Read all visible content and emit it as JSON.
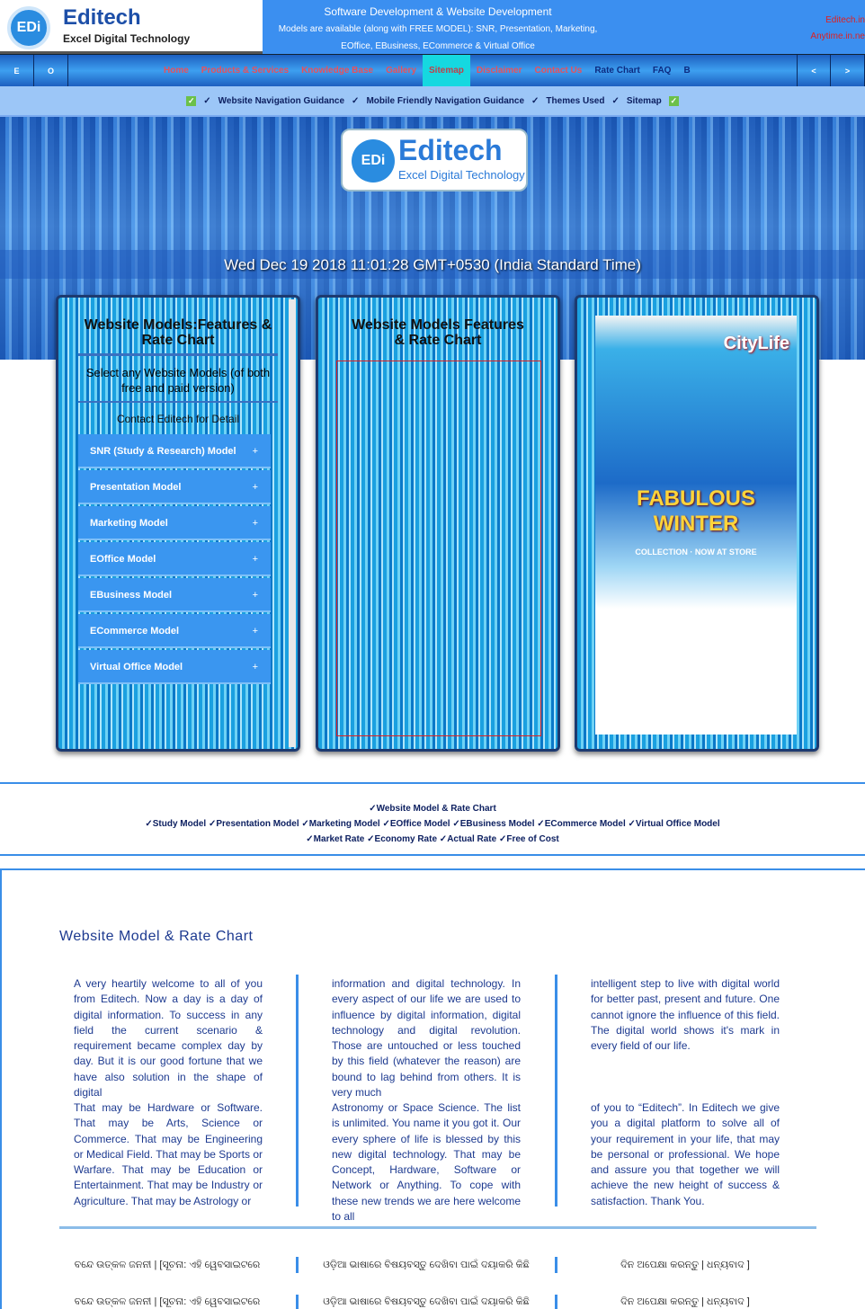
{
  "header": {
    "brand": "Editech",
    "tagline": "Excel Digital Technology",
    "logo_mark": "EDi",
    "promo": [
      "Software Development & Website Development",
      "Models are available (along with FREE MODEL): SNR, Presentation, Marketing,",
      "EOffice, EBusiness, ECommerce & Virtual Office"
    ],
    "side_links": [
      "Editech.in",
      "Anytime.in.ne"
    ]
  },
  "nav": {
    "left_buttons": [
      "E",
      "O"
    ],
    "right_buttons": [
      "<",
      ">"
    ],
    "items": [
      {
        "label": "Home"
      },
      {
        "label": "Products & Services"
      },
      {
        "label": "Knowledge Base"
      },
      {
        "label": "Gallery"
      },
      {
        "label": "Sitemap",
        "active": true
      },
      {
        "label": "Disclaimer"
      },
      {
        "label": "Contact Us"
      },
      {
        "label": "Rate Chart"
      },
      {
        "label": "FAQ"
      },
      {
        "label": "B"
      }
    ]
  },
  "guidance": {
    "items": [
      "Website Navigation Guidance",
      "Mobile Friendly Navigation Guidance",
      "Themes Used",
      "Sitemap"
    ]
  },
  "hero": {
    "brand": "Editech",
    "tagline": "Excel Digital Technology",
    "datetime": "Wed Dec 19 2018 11:01:28 GMT+0530 (India Standard Time)"
  },
  "panel1": {
    "title": "Website Models:Features & Rate Chart",
    "subtitle": "Select any Website Models (of both free and paid version)",
    "contact": "Contact Editech for Detail",
    "models": [
      "SNR (Study & Research) Model",
      "Presentation Model",
      "Marketing Model",
      "EOffice Model",
      "EBusiness Model",
      "ECommerce Model",
      "Virtual Office Model"
    ]
  },
  "panel2": {
    "title": "Website Models Features & Rate Chart"
  },
  "panel3": {
    "ad_brand": "CityLife",
    "ad_headline": "FABULOUS WINTER",
    "ad_sub": "COLLECTION · NOW AT STORE"
  },
  "links": {
    "line1": [
      "Website Model & Rate Chart"
    ],
    "line2": [
      "Study Model",
      "Presentation Model",
      "Marketing Model",
      "EOffice Model",
      "EBusiness Model",
      "ECommerce Model",
      "Virtual Office Model"
    ],
    "line3": [
      "Market Rate",
      "Economy Rate",
      "Actual Rate",
      "Free of Cost"
    ]
  },
  "content": {
    "title": "Website Model & Rate Chart",
    "paragraphs": [
      "A very heartily welcome to all of you from Editech. Now a day is a day of digital information. To success in any field the current scenario & requirement became complex day by day. But it is our good fortune that we have also solution in the shape of digital",
      "information and digital technology. In every aspect of our life we are used to influence by digital information, digital technology and digital revolution. Those are untouched or less touched by this field (whatever the reason) are bound to lag behind from others. It is very much",
      "intelligent step to live with digital world for better past, present and future. One cannot ignore the influence of this field. The digital world shows it's mark in every field of our life.",
      "That may be Hardware or Software. That may be Arts, Science or Commerce. That may be Engineering or Medical Field. That may be Sports or Warfare. That may be Education or Entertainment. That may be Industry or Agriculture. That may be Astrology or",
      "Astronomy or Space Science. The list is unlimited. You name it you got it. Our every sphere of life is blessed by this new digital technology. That may be Concept, Hardware, Software or Network or Anything. To cope with these new trends we are here welcome to all",
      "of you to “Editech”. In Editech we give you a digital platform to solve all of your requirement in your life, that may be personal or professional. We hope and assure you that together we will achieve the new height of success & satisfaction. Thank You."
    ]
  },
  "odia": [
    "ବନ୍ଦେ ଉତ୍କଳ ଜନନୀ | [ସୂଚନା: ଏହି ୱେବସାଇଟରେ",
    "ଓଡ଼ିଆ ଭାଷାରେ ବିଷୟବସ୍ତୁ ଦେଖିବା ପାଇଁ ଦୟାକରି କିଛି",
    "ଦିନ ଅପେକ୍ଷା କରନ୍ତୁ | ଧନ୍ୟବାଦ ]"
  ],
  "colors": {
    "accent": "#3b8ff0",
    "nav_text": "#e8505a",
    "active_tab": "#15d8e0",
    "body_text": "#1d3a90"
  }
}
